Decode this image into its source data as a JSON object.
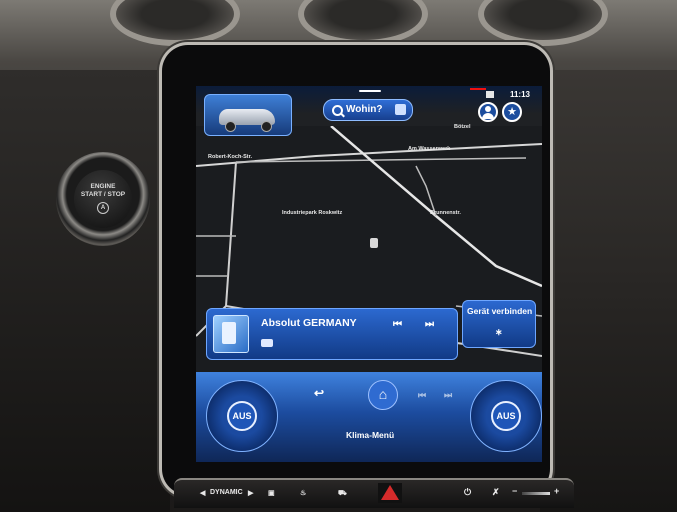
{
  "engine": {
    "line1": "ENGINE",
    "line2": "START / STOP",
    "logo": "A"
  },
  "nav": {
    "search_label": "Wohin?",
    "time": "11:13"
  },
  "map": {
    "road_labels": [
      "Robert-Koch-Str.",
      "Am Wasserwerk",
      "Industriepark Roskwitz",
      "Brunnenstr.",
      "Bötzel"
    ]
  },
  "media": {
    "station": "Absolut GERMANY",
    "prev": "⏮",
    "next": "⏭"
  },
  "connect": {
    "label": "Gerät verbinden",
    "icon": "∗"
  },
  "climate": {
    "left_label": "AUS",
    "right_label": "AUS",
    "menu_label": "Klima-Menü",
    "back": "↩"
  },
  "hardware": {
    "dynamic_left": "◀",
    "dynamic_label": "DYNAMIC",
    "dynamic_right": "▶",
    "power": "⏻",
    "plus": "+",
    "minus": "−"
  }
}
